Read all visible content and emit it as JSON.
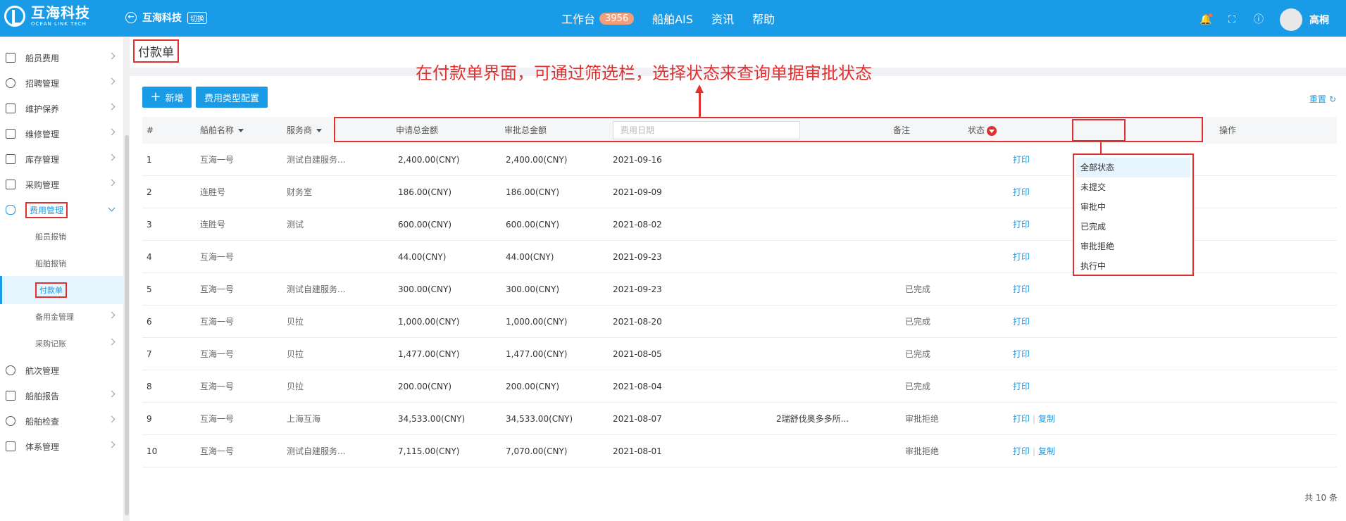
{
  "header": {
    "logo_cn": "互海科技",
    "logo_en": "OCEAN LINK TECH",
    "company": "互海科技",
    "company_badge": "切换",
    "nav": [
      {
        "label": "工作台",
        "badge": "3956"
      },
      {
        "label": "船舶AIS"
      },
      {
        "label": "资讯"
      },
      {
        "label": "帮助"
      }
    ],
    "user": "高桐"
  },
  "sidebar": {
    "items": [
      {
        "label": "船员费用"
      },
      {
        "label": "招聘管理"
      },
      {
        "label": "维护保养"
      },
      {
        "label": "维修管理"
      },
      {
        "label": "库存管理"
      },
      {
        "label": "采购管理"
      },
      {
        "label": "费用管理"
      },
      {
        "label": "航次管理"
      },
      {
        "label": "船舶报告"
      },
      {
        "label": "船舶检查"
      },
      {
        "label": "体系管理"
      }
    ],
    "sub_items": [
      {
        "label": "船员报销"
      },
      {
        "label": "船舶报销"
      },
      {
        "label": "付款单"
      },
      {
        "label": "备用金管理"
      },
      {
        "label": "采购记账"
      }
    ]
  },
  "page": {
    "title": "付款单",
    "annotation": "在付款单界面，可通过筛选栏，选择状态来查询单据审批状态",
    "add_button": "新增",
    "config_button": "费用类型配置",
    "reset": "重置",
    "total": "共 10 条"
  },
  "table": {
    "headers": {
      "index": "#",
      "ship": "船舶名称",
      "provider": "服务商",
      "apply_total": "申请总金额",
      "approve_total": "审批总金额",
      "date_placeholder": "费用日期",
      "remark": "备注",
      "status": "状态",
      "action": "操作"
    },
    "rows": [
      {
        "idx": "1",
        "ship": "互海一号",
        "provider": "测试自建服务...",
        "apply": "2,400.00(CNY)",
        "approve": "2,400.00(CNY)",
        "date": "2021-09-16",
        "remark": "",
        "status": "",
        "print": "打印",
        "copy": ""
      },
      {
        "idx": "2",
        "ship": "连胜号",
        "provider": "财务室",
        "apply": "186.00(CNY)",
        "approve": "186.00(CNY)",
        "date": "2021-09-09",
        "remark": "",
        "status": "",
        "print": "打印",
        "copy": ""
      },
      {
        "idx": "3",
        "ship": "连胜号",
        "provider": "测试",
        "apply": "600.00(CNY)",
        "approve": "600.00(CNY)",
        "date": "2021-08-02",
        "remark": "",
        "status": "",
        "print": "打印",
        "copy": ""
      },
      {
        "idx": "4",
        "ship": "互海一号",
        "provider": "",
        "apply": "44.00(CNY)",
        "approve": "44.00(CNY)",
        "date": "2021-09-23",
        "remark": "",
        "status": "",
        "print": "打印",
        "copy": ""
      },
      {
        "idx": "5",
        "ship": "互海一号",
        "provider": "测试自建服务...",
        "apply": "300.00(CNY)",
        "approve": "300.00(CNY)",
        "date": "2021-09-23",
        "remark": "",
        "status": "已完成",
        "print": "打印",
        "copy": ""
      },
      {
        "idx": "6",
        "ship": "互海一号",
        "provider": "贝拉",
        "apply": "1,000.00(CNY)",
        "approve": "1,000.00(CNY)",
        "date": "2021-08-20",
        "remark": "",
        "status": "已完成",
        "print": "打印",
        "copy": ""
      },
      {
        "idx": "7",
        "ship": "互海一号",
        "provider": "贝拉",
        "apply": "1,477.00(CNY)",
        "approve": "1,477.00(CNY)",
        "date": "2021-08-05",
        "remark": "",
        "status": "已完成",
        "print": "打印",
        "copy": ""
      },
      {
        "idx": "8",
        "ship": "互海一号",
        "provider": "贝拉",
        "apply": "200.00(CNY)",
        "approve": "200.00(CNY)",
        "date": "2021-08-04",
        "remark": "",
        "status": "已完成",
        "print": "打印",
        "copy": ""
      },
      {
        "idx": "9",
        "ship": "互海一号",
        "provider": "上海互海",
        "apply": "34,533.00(CNY)",
        "approve": "34,533.00(CNY)",
        "date": "2021-08-07",
        "remark": "2瑞舒伐奥多多所...",
        "status": "审批拒绝",
        "print": "打印",
        "copy": "复制"
      },
      {
        "idx": "10",
        "ship": "互海一号",
        "provider": "测试自建服务...",
        "apply": "7,115.00(CNY)",
        "approve": "7,070.00(CNY)",
        "date": "2021-08-01",
        "remark": "",
        "status": "审批拒绝",
        "print": "打印",
        "copy": "复制"
      }
    ]
  },
  "status_dropdown": {
    "options": [
      "全部状态",
      "未提交",
      "审批中",
      "已完成",
      "审批拒绝",
      "执行中"
    ],
    "selected": "全部状态"
  },
  "colors": {
    "primary": "#1a9be8",
    "annotation": "#e03030"
  }
}
